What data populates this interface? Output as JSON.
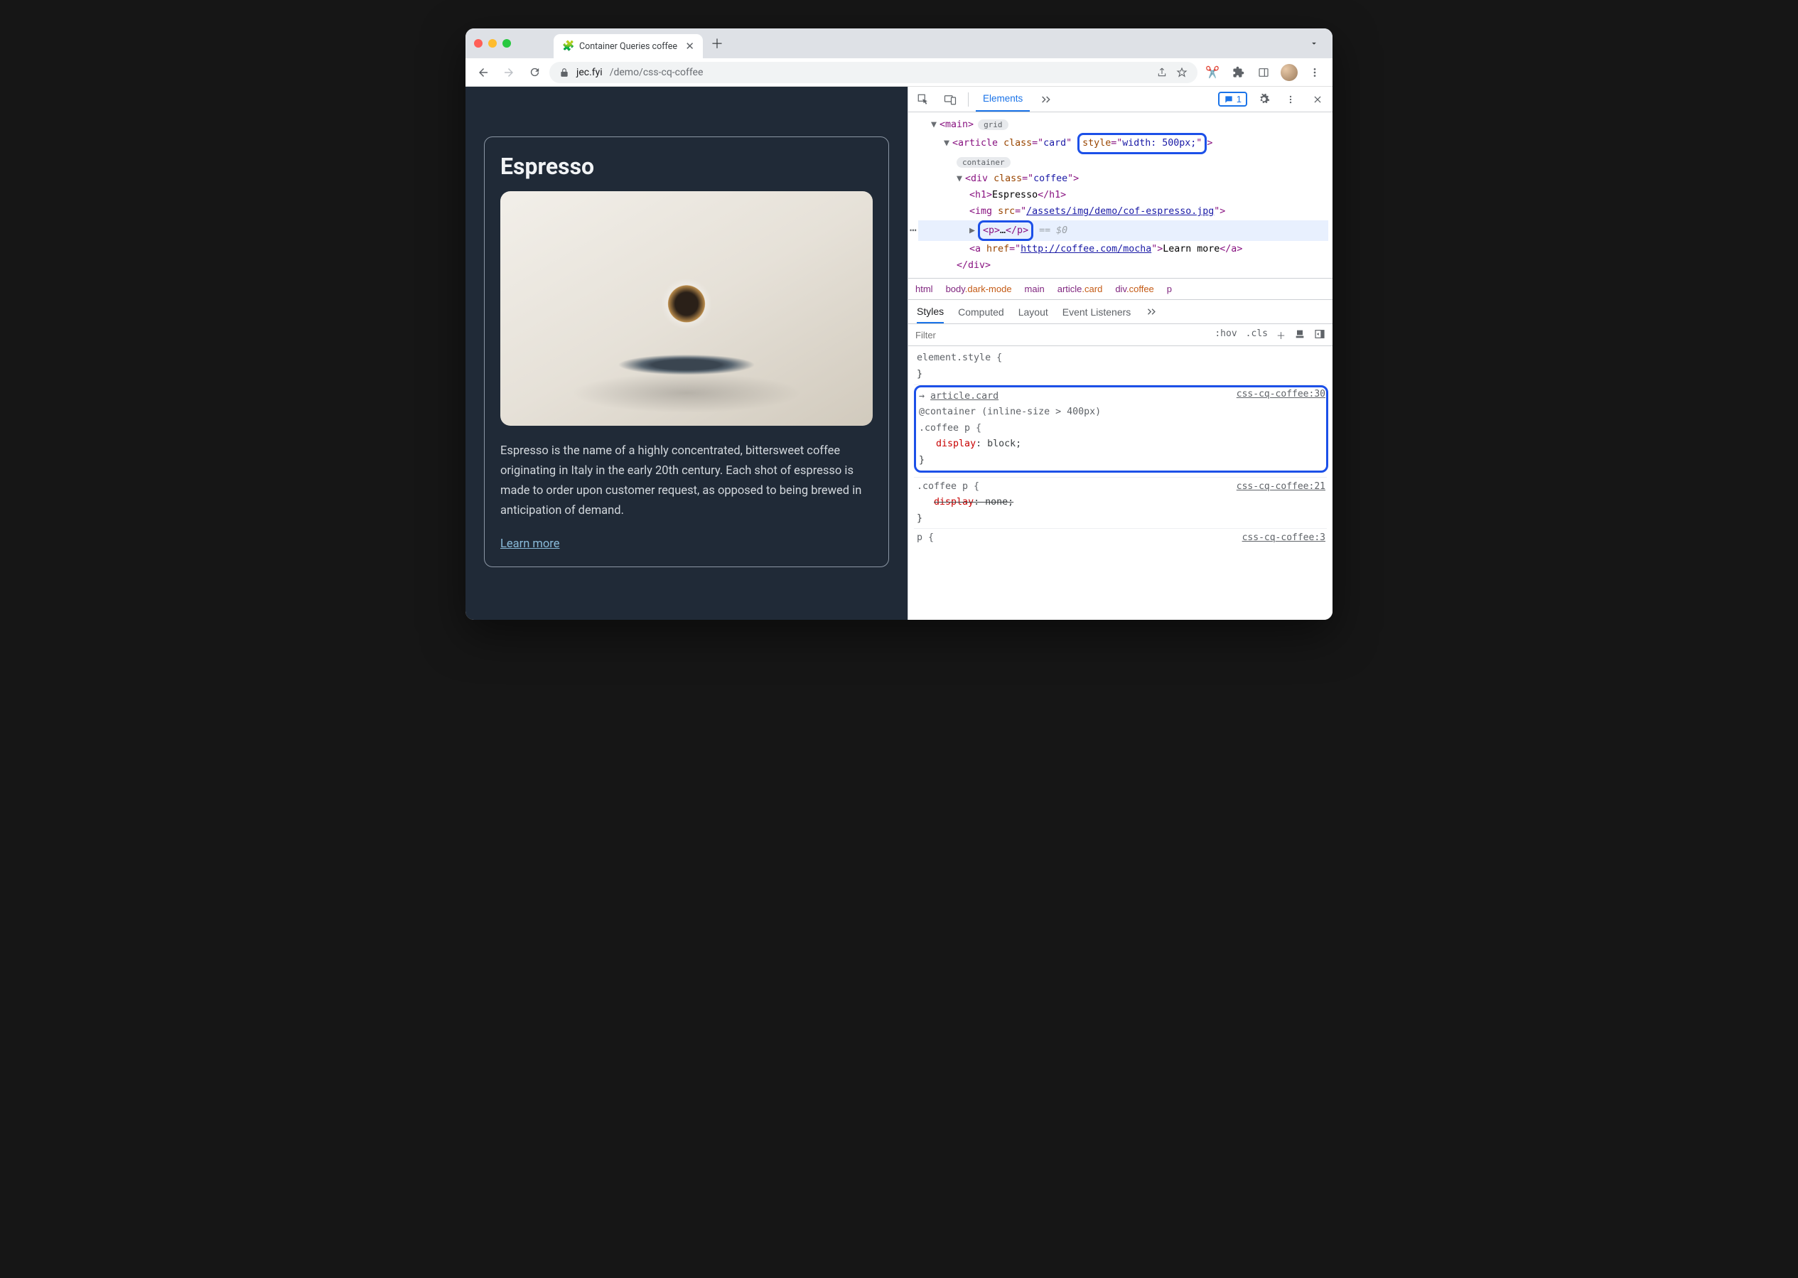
{
  "tab": {
    "title": "Container Queries coffee"
  },
  "url": {
    "host": "jec.fyi",
    "path": "/demo/css-cq-coffee"
  },
  "page": {
    "title": "Espresso",
    "body": "Espresso is the name of a highly concentrated, bittersweet coffee originating in Italy in the early 20th century. Each shot of espresso is made to order upon customer request, as opposed to being brewed in anticipation of demand.",
    "link": "Learn more"
  },
  "devtools": {
    "panel": "Elements",
    "issue_count": "1",
    "dom": {
      "main": "main",
      "main_badge": "grid",
      "article": {
        "tag": "article",
        "cls_attr": "class",
        "cls_val": "card",
        "style_attr": "style",
        "style_val": "width: 500px;",
        "badge": "container"
      },
      "div": {
        "tag": "div",
        "cls_attr": "class",
        "cls_val": "coffee"
      },
      "h1": {
        "open": "<h1>",
        "text": "Espresso",
        "close": "</h1>"
      },
      "img": {
        "tag": "img",
        "src_attr": "src",
        "src_val": "/assets/img/demo/cof-espresso.jpg"
      },
      "p": {
        "open": "<p>",
        "ell": "…",
        "close": "</p>",
        "eq": "== $0"
      },
      "a": {
        "tag": "a",
        "href_attr": "href",
        "href_val": "http://coffee.com/mocha",
        "text": "Learn more",
        "close": "</a>"
      },
      "div_close": "</div>"
    },
    "crumbs": [
      "html",
      "body.dark-mode",
      "main",
      "article.card",
      "div.coffee",
      "p"
    ],
    "styles_tabs": [
      "Styles",
      "Computed",
      "Layout",
      "Event Listeners"
    ],
    "filter_placeholder": "Filter",
    "filter_tools": {
      "hov": ":hov",
      "cls": ".cls"
    },
    "rules": {
      "elstyle": "element.style {",
      "close": "}",
      "r1": {
        "arrow": "→",
        "inherit": "article.card",
        "at": "@container",
        "cond": "(inline-size > 400px)",
        "sel": ".coffee p {",
        "prop": "display",
        "val": "block",
        "src": "css-cq-coffee:30"
      },
      "r2": {
        "sel": ".coffee p {",
        "prop": "display",
        "val": "none",
        "src": "css-cq-coffee:21"
      },
      "r3": {
        "sel": "p {",
        "src": "css-cq-coffee:3"
      }
    }
  }
}
